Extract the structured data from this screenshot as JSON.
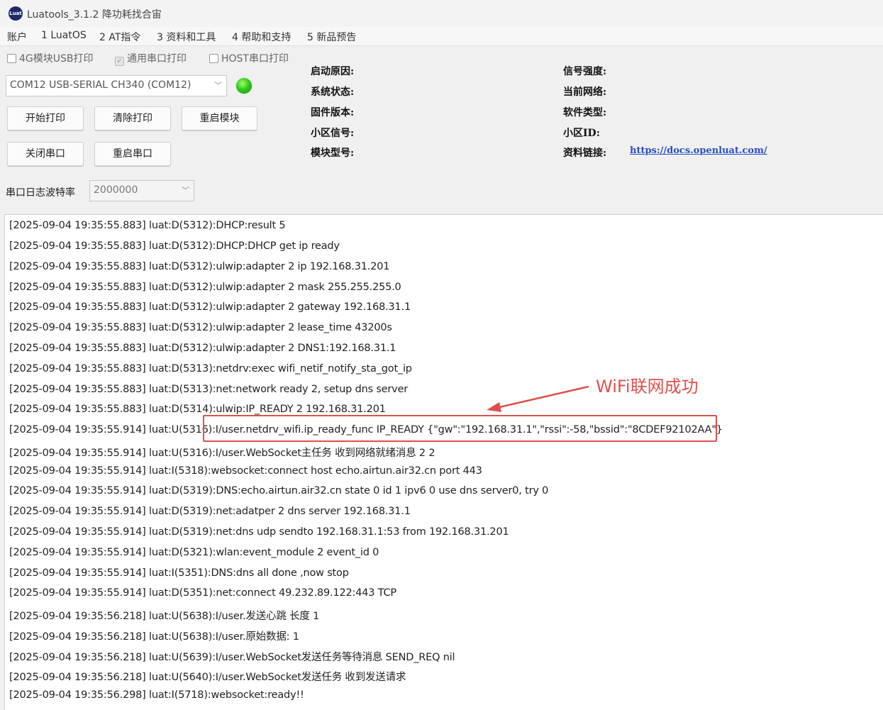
{
  "window": {
    "title": "Luatools_3.1.2 降功耗找合宙",
    "icon_name": "luat-logo-icon",
    "icon_text": "Luat"
  },
  "menu": [
    "账户",
    "1 LuatOS",
    "2 AT指令",
    "3 资料和工具",
    "4 帮助和支持",
    "5 新品预告"
  ],
  "checkboxes": [
    {
      "label": "4G模块USB打印",
      "checked": false
    },
    {
      "label": "通用串口打印",
      "checked": true
    },
    {
      "label": "HOST串口打印",
      "checked": false
    }
  ],
  "port": {
    "selected": "COM12 USB-SERIAL CH340 (COM12)",
    "status_color": "#35c91b"
  },
  "buttons": {
    "start_print": "开始打印",
    "clear_print": "清除打印",
    "restart_module": "重启模块",
    "close_port": "关闭串口",
    "restart_port": "重启串口"
  },
  "baud": {
    "label": "串口日志波特率",
    "value": "2000000"
  },
  "info": {
    "boot_reason": "启动原因:",
    "system_status": "系统状态:",
    "firmware_version": "固件版本:",
    "cell_signal": "小区信号:",
    "module_model": "模块型号:",
    "signal_strength": "信号强度:",
    "current_network": "当前网络:",
    "software_type": "软件类型:",
    "cell_id": "小区ID:",
    "docs_link_label": "资料链接:",
    "docs_link": "https://docs.openluat.com/"
  },
  "log_lines": [
    "[2025-09-04 19:35:55.883] luat:D(5312):DHCP:result 5",
    "[2025-09-04 19:35:55.883] luat:D(5312):DHCP:DHCP get ip ready",
    "[2025-09-04 19:35:55.883] luat:D(5312):ulwip:adapter 2 ip 192.168.31.201",
    "[2025-09-04 19:35:55.883] luat:D(5312):ulwip:adapter 2 mask 255.255.255.0",
    "[2025-09-04 19:35:55.883] luat:D(5312):ulwip:adapter 2 gateway 192.168.31.1",
    "[2025-09-04 19:35:55.883] luat:D(5312):ulwip:adapter 2 lease_time 43200s",
    "[2025-09-04 19:35:55.883] luat:D(5312):ulwip:adapter 2 DNS1:192.168.31.1",
    "[2025-09-04 19:35:55.883] luat:D(5313):netdrv:exec wifi_netif_notify_sta_got_ip",
    "[2025-09-04 19:35:55.883] luat:D(5313):net:network ready 2, setup dns server",
    "[2025-09-04 19:35:55.883] luat:D(5314):ulwip:IP_READY 2 192.168.31.201",
    "[2025-09-04 19:35:55.914] luat:U(5316):I/user.netdrv_wifi.ip_ready_func IP_READY {\"gw\":\"192.168.31.1\",\"rssi\":-58,\"bssid\":\"8CDEF92102AA\"}",
    "[2025-09-04 19:35:55.914] luat:U(5316):I/user.WebSocket主任务 收到网络就绪消息 2 2",
    "[2025-09-04 19:35:55.914] luat:I(5318):websocket:connect host echo.airtun.air32.cn port 443",
    "[2025-09-04 19:35:55.914] luat:D(5319):DNS:echo.airtun.air32.cn state 0 id 1 ipv6 0 use dns server0, try 0",
    "[2025-09-04 19:35:55.914] luat:D(5319):net:adatper 2 dns server 192.168.31.1",
    "[2025-09-04 19:35:55.914] luat:D(5319):net:dns udp sendto 192.168.31.1:53 from 192.168.31.201",
    "[2025-09-04 19:35:55.914] luat:D(5321):wlan:event_module 2 event_id 0",
    "[2025-09-04 19:35:55.914] luat:I(5351):DNS:dns all done ,now stop",
    "[2025-09-04 19:35:55.914] luat:D(5351):net:connect 49.232.89.122:443 TCP",
    "[2025-09-04 19:35:56.218] luat:U(5638):I/user.发送心跳 长度 1",
    "[2025-09-04 19:35:56.218] luat:U(5638):I/user.原始数据: 1",
    "[2025-09-04 19:35:56.218] luat:U(5639):I/user.WebSocket发送任务等待消息 SEND_REQ nil",
    "[2025-09-04 19:35:56.218] luat:U(5640):I/user.WebSocket发送任务 收到发送请求",
    "[2025-09-04 19:35:56.298] luat:I(5718):websocket:ready!!"
  ],
  "annotation": {
    "text": "WiFi联网成功",
    "color": "#e0504c"
  }
}
